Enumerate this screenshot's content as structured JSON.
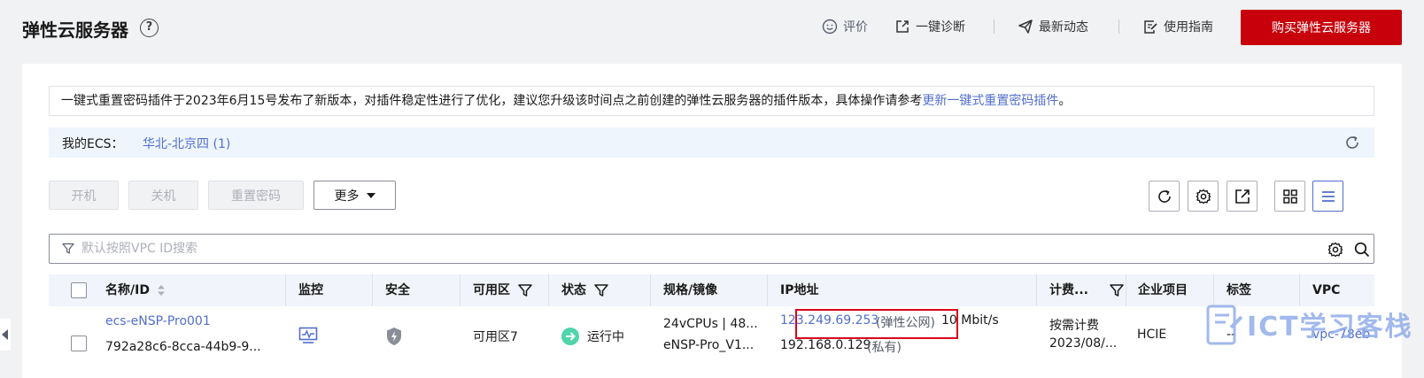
{
  "header": {
    "title": "弹性云服务器",
    "help": "?",
    "links": {
      "rating": "评价",
      "diagnose": "一键诊断",
      "news": "最新动态",
      "guide": "使用指南"
    },
    "buy_button": "购买弹性云服务器"
  },
  "notice": {
    "text": "一键式重置密码插件于2023年6月15号发布了新版本，对插件稳定性进行了优化，建议您升级该时间点之前创建的弹性云服务器的插件版本，具体操作请参考",
    "link_text": "更新一键式重置密码插件",
    "suffix": "。"
  },
  "region_bar": {
    "label": "我的ECS：",
    "region": "华北-北京四 (1)"
  },
  "toolbar": {
    "start": "开机",
    "stop": "关机",
    "reset_password": "重置密码",
    "more": "更多"
  },
  "search": {
    "placeholder": "默认按照VPC ID搜索"
  },
  "table": {
    "columns": {
      "name": "名称/ID",
      "monitor": "监控",
      "security": "安全",
      "az": "可用区",
      "status": "状态",
      "spec": "规格/镜像",
      "ip": "IP地址",
      "billing": "计费...",
      "project": "企业项目",
      "tag": "标签",
      "vpc": "VPC"
    },
    "rows": [
      {
        "name": "ecs-eNSP-Pro001",
        "id": "792a28c6-8cca-44b9-9...",
        "az": "可用区7",
        "status": "运行中",
        "spec": "24vCPUs | 48...",
        "image": "eNSP-Pro_V1...",
        "public_ip": "123.249.69.253",
        "public_ip_type": "(弹性公网)",
        "bandwidth": "10 Mbit/s",
        "private_ip": "192.168.0.129",
        "private_ip_type": "(私有)",
        "billing": "按需计费",
        "billing_date": "2023/08/...",
        "project": "HCIE",
        "tag": "--",
        "vpc": "vpc-78eb"
      }
    ]
  },
  "watermark": {
    "text": "ICT学习客栈"
  },
  "colors": {
    "brand_red": "#c7000b",
    "link_blue": "#526ecc",
    "running_green": "#50d4ab",
    "highlight_red": "#d9001b"
  }
}
